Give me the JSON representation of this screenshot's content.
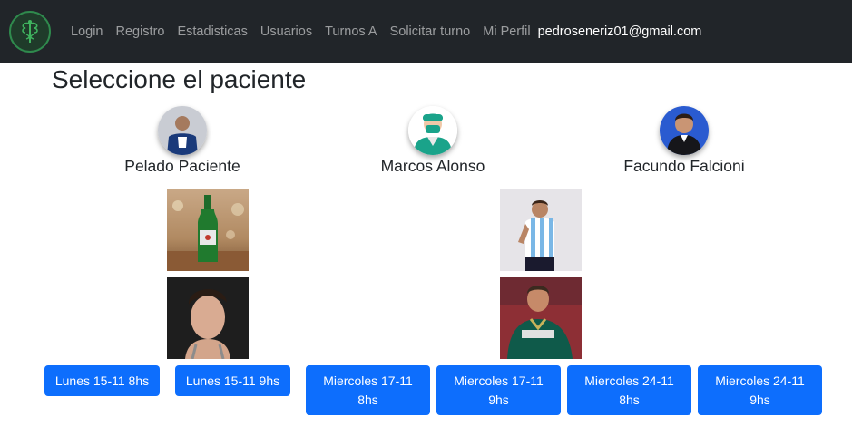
{
  "nav": {
    "links": [
      "Login",
      "Registro",
      "Estadisticas",
      "Usuarios",
      "Turnos A",
      "Solicitar turno",
      "Mi Perfil"
    ],
    "user_email": "pedroseneriz01@gmail.com"
  },
  "page": {
    "title": "Seleccione el paciente"
  },
  "patients": [
    {
      "name": "Pelado Paciente"
    },
    {
      "name": "Marcos Alonso"
    },
    {
      "name": "Facundo Falcioni"
    }
  ],
  "slots": [
    {
      "label": "Lunes 15-11 8hs"
    },
    {
      "label": "Lunes 15-11 9hs"
    },
    {
      "label": "Miercoles 17-11 8hs"
    },
    {
      "label": "Miercoles 17-11 9hs"
    },
    {
      "label": "Miercoles 24-11 8hs"
    },
    {
      "label": "Miercoles 24-11 9hs"
    }
  ],
  "colors": {
    "navbar": "#212529",
    "primary": "#0d6efd",
    "logo_green": "#2f8a4d"
  },
  "icons": {
    "logo": "caduceus-logo-icon"
  }
}
